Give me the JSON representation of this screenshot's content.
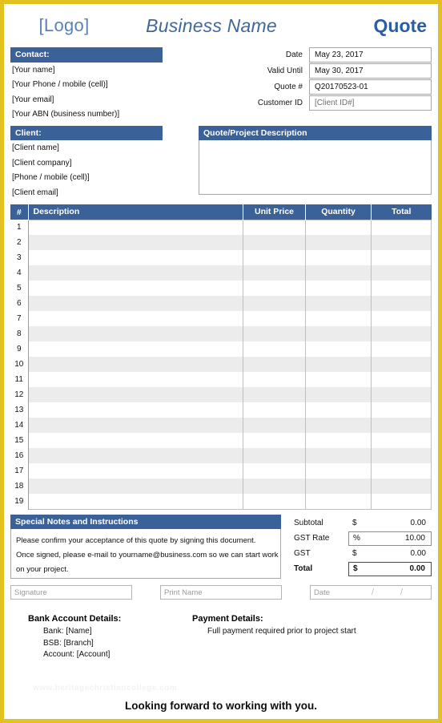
{
  "colors": {
    "border": "#e3c11e",
    "band": "#3a6198",
    "title": "#2c5ca5",
    "business_name": "#41689e",
    "logo": "#5b81b5",
    "row_stripe": "#ececec"
  },
  "header": {
    "logo": "[Logo]",
    "business_name": "Business Name",
    "doc_title": "Quote"
  },
  "contact": {
    "heading": "Contact:",
    "lines": [
      "[Your name]",
      "[Your Phone / mobile (cell)]",
      "[Your email]",
      "[Your ABN (business number)]"
    ]
  },
  "client": {
    "heading": "Client:",
    "lines": [
      "[Client name]",
      "[Client company]",
      "[Phone / mobile (cell)]",
      "[Client email]"
    ]
  },
  "meta": [
    {
      "label": "Date",
      "value": "May 23, 2017",
      "placeholder": false
    },
    {
      "label": "Valid Until",
      "value": "May 30, 2017",
      "placeholder": false
    },
    {
      "label": "Quote #",
      "value": "Q20170523-01",
      "placeholder": false
    },
    {
      "label": "Customer ID",
      "value": "[Client ID#]",
      "placeholder": true
    }
  ],
  "description": {
    "heading": "Quote/Project Description",
    "value": ""
  },
  "items": {
    "columns": [
      "#",
      "Description",
      "Unit Price",
      "Quantity",
      "Total"
    ],
    "rows": [
      {
        "n": "1",
        "description": "",
        "unit_price": "",
        "quantity": "",
        "total": ""
      },
      {
        "n": "2",
        "description": "",
        "unit_price": "",
        "quantity": "",
        "total": ""
      },
      {
        "n": "3",
        "description": "",
        "unit_price": "",
        "quantity": "",
        "total": ""
      },
      {
        "n": "4",
        "description": "",
        "unit_price": "",
        "quantity": "",
        "total": ""
      },
      {
        "n": "5",
        "description": "",
        "unit_price": "",
        "quantity": "",
        "total": ""
      },
      {
        "n": "6",
        "description": "",
        "unit_price": "",
        "quantity": "",
        "total": ""
      },
      {
        "n": "7",
        "description": "",
        "unit_price": "",
        "quantity": "",
        "total": ""
      },
      {
        "n": "8",
        "description": "",
        "unit_price": "",
        "quantity": "",
        "total": ""
      },
      {
        "n": "9",
        "description": "",
        "unit_price": "",
        "quantity": "",
        "total": ""
      },
      {
        "n": "10",
        "description": "",
        "unit_price": "",
        "quantity": "",
        "total": ""
      },
      {
        "n": "11",
        "description": "",
        "unit_price": "",
        "quantity": "",
        "total": ""
      },
      {
        "n": "12",
        "description": "",
        "unit_price": "",
        "quantity": "",
        "total": ""
      },
      {
        "n": "13",
        "description": "",
        "unit_price": "",
        "quantity": "",
        "total": ""
      },
      {
        "n": "14",
        "description": "",
        "unit_price": "",
        "quantity": "",
        "total": ""
      },
      {
        "n": "15",
        "description": "",
        "unit_price": "",
        "quantity": "",
        "total": ""
      },
      {
        "n": "16",
        "description": "",
        "unit_price": "",
        "quantity": "",
        "total": ""
      },
      {
        "n": "17",
        "description": "",
        "unit_price": "",
        "quantity": "",
        "total": ""
      },
      {
        "n": "18",
        "description": "",
        "unit_price": "",
        "quantity": "",
        "total": ""
      },
      {
        "n": "19",
        "description": "",
        "unit_price": "",
        "quantity": "",
        "total": ""
      }
    ]
  },
  "notes": {
    "heading": "Special Notes and Instructions",
    "lines": [
      "Please confirm your acceptance of this quote by signing this document.",
      "Once signed, please e-mail to yourname@business.com so we can start work",
      "on your project."
    ]
  },
  "totals": [
    {
      "label": "Subtotal",
      "symbol": "$",
      "amount": "0.00",
      "boxed": false,
      "grand": false
    },
    {
      "label": "GST Rate",
      "symbol": "%",
      "amount": "10.00",
      "boxed": true,
      "grand": false
    },
    {
      "label": "GST",
      "symbol": "$",
      "amount": "0.00",
      "boxed": false,
      "grand": false
    },
    {
      "label": "Total",
      "symbol": "$",
      "amount": "0.00",
      "boxed": false,
      "grand": true
    }
  ],
  "signature": {
    "signature_placeholder": "Signature",
    "print_name_placeholder": "Print Name",
    "date_placeholder": "Date",
    "slash": "/"
  },
  "bank": {
    "heading": "Bank Account Details:",
    "lines": [
      "Bank: [Name]",
      "BSB: [Branch]",
      "Account: [Account]"
    ]
  },
  "payment": {
    "heading": "Payment Details:",
    "lines": [
      "Full payment required prior to project start"
    ]
  },
  "watermark": "www.heritagechristiancollege.com",
  "footer_message": "Looking forward to working with you."
}
